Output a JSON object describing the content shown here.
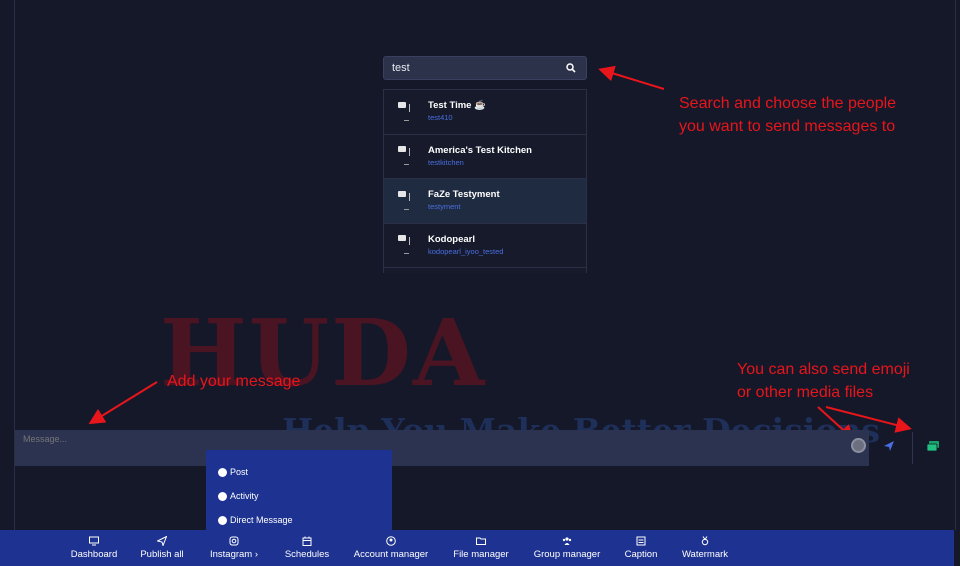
{
  "search": {
    "value": "test",
    "icon": "search-icon"
  },
  "results": [
    {
      "name": "Test Time ☕",
      "handle": "test410"
    },
    {
      "name": "America's Test Kitchen",
      "handle": "testkitchen"
    },
    {
      "name": "FaZe Testyment",
      "handle": "testyment"
    },
    {
      "name": "Kodopearl",
      "handle": "kodopearl_iyoo_tested"
    }
  ],
  "watermark": {
    "big": "HUDA",
    "small": "Help You Make Better Decisions"
  },
  "annotations": {
    "search_line1": "Search and choose the people",
    "search_line2": "you want to send messages to",
    "message": "Add your message",
    "media_line1": "You can also send emoji",
    "media_line2": "or other media files",
    "color": "#e8151b"
  },
  "message": {
    "placeholder": "Message..."
  },
  "dropdown": {
    "options": [
      "Post",
      "Activity",
      "Direct Message"
    ]
  },
  "nav": {
    "items": [
      {
        "label": "Dashboard",
        "icon": "monitor-icon"
      },
      {
        "label": "Publish all",
        "icon": "paper-plane-icon"
      },
      {
        "label": "Instagram  ›",
        "icon": "instagram-icon"
      },
      {
        "label": "Schedules",
        "icon": "calendar-icon"
      },
      {
        "label": "Account manager",
        "icon": "user-circle-icon"
      },
      {
        "label": "File manager",
        "icon": "folder-open-icon"
      },
      {
        "label": "Group manager",
        "icon": "users-icon"
      },
      {
        "label": "Caption",
        "icon": "caption-icon"
      },
      {
        "label": "Watermark",
        "icon": "award-icon"
      }
    ]
  },
  "colors": {
    "background": "#151829",
    "nav": "#1e3391",
    "input": "#2c3350",
    "handle": "#4a6ee0"
  }
}
